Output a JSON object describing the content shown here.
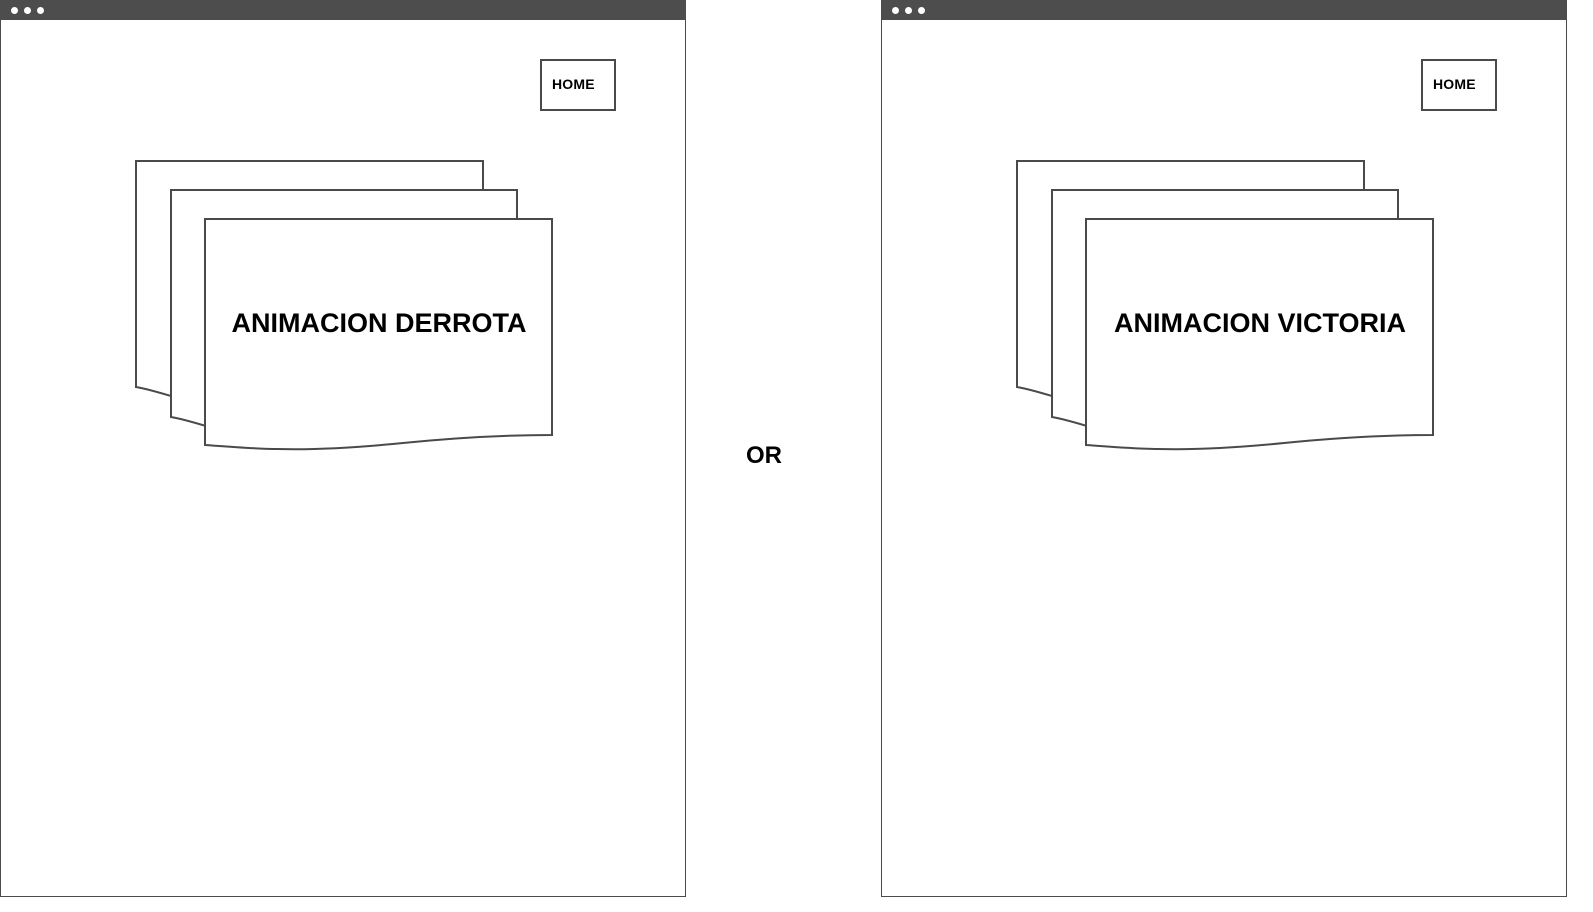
{
  "screens": [
    {
      "home_label": "HOME",
      "animation_label": "ANIMACION DERROTA"
    },
    {
      "home_label": "HOME",
      "animation_label": "ANIMACION VICTORIA"
    }
  ],
  "separator_label": "OR",
  "colors": {
    "stroke": "#4a4a4a",
    "titlebar": "#4d4d4d",
    "background": "#ffffff"
  }
}
